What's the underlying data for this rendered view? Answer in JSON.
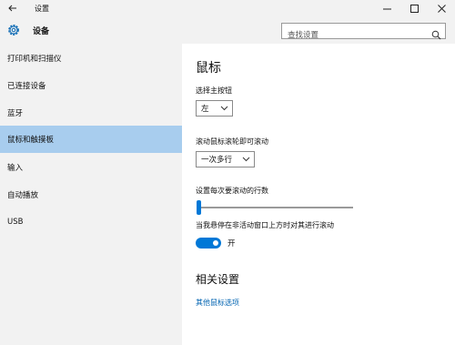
{
  "window": {
    "title": "设置"
  },
  "header": {
    "title": "设备",
    "search_placeholder": "查找设置"
  },
  "sidebar": {
    "items": [
      {
        "label": "打印机和扫描仪"
      },
      {
        "label": "已连接设备"
      },
      {
        "label": "蓝牙"
      },
      {
        "label": "鼠标和触摸板",
        "selected": true
      },
      {
        "label": "输入"
      },
      {
        "label": "自动播放"
      },
      {
        "label": "USB"
      }
    ]
  },
  "main": {
    "title": "鼠标",
    "primary_button": {
      "label": "选择主按钮",
      "value": "左"
    },
    "wheel_scroll": {
      "label": "滚动鼠标滚轮即可滚动",
      "value": "一次多行"
    },
    "lines_per_scroll": {
      "label": "设置每次要滚动的行数",
      "fraction": 0.0
    },
    "inactive_scroll": {
      "label": "当我悬停在非活动窗口上方时对其进行滚动",
      "state": "开",
      "on": true
    },
    "related_title": "相关设置",
    "related_link": "其他鼠标选项"
  },
  "icons": [
    "back-arrow-icon",
    "minimize-icon",
    "maximize-icon",
    "close-icon",
    "gear-icon",
    "search-icon",
    "chevron-down-icon"
  ],
  "colors": {
    "accent": "#0078d7",
    "selected_nav": "#a8cdee",
    "link": "#0063b1",
    "chrome": "#f2f2f2"
  }
}
